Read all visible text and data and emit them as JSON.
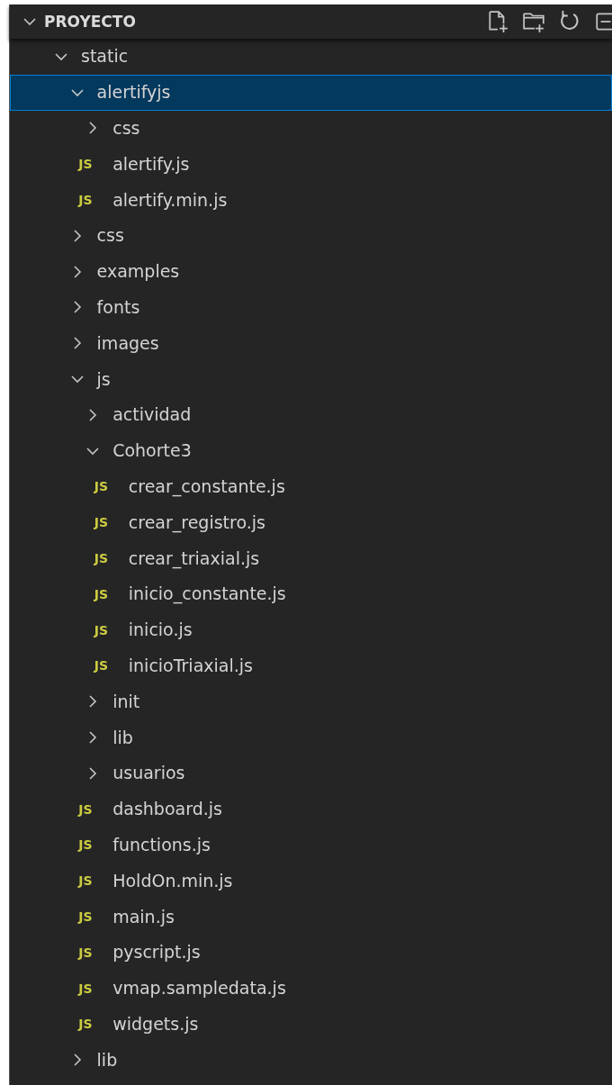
{
  "explorer": {
    "title": "PROYECTO",
    "expanded": true
  },
  "tree": [
    {
      "kind": "folder",
      "name": "static",
      "expanded": true,
      "selected": false,
      "children": [
        {
          "kind": "folder",
          "name": "alertifyjs",
          "expanded": true,
          "selected": true,
          "children": [
            {
              "kind": "folder",
              "name": "css",
              "expanded": false,
              "selected": false
            },
            {
              "kind": "file",
              "icon_text": "JS",
              "name": "alertify.js",
              "selected": false
            },
            {
              "kind": "file",
              "icon_text": "JS",
              "name": "alertify.min.js",
              "selected": false
            }
          ]
        },
        {
          "kind": "folder",
          "name": "css",
          "expanded": false,
          "selected": false
        },
        {
          "kind": "folder",
          "name": "examples",
          "expanded": false,
          "selected": false
        },
        {
          "kind": "folder",
          "name": "fonts",
          "expanded": false,
          "selected": false
        },
        {
          "kind": "folder",
          "name": "images",
          "expanded": false,
          "selected": false
        },
        {
          "kind": "folder",
          "name": "js",
          "expanded": true,
          "selected": false,
          "children": [
            {
              "kind": "folder",
              "name": "actividad",
              "expanded": false,
              "selected": false
            },
            {
              "kind": "folder",
              "name": "Cohorte3",
              "expanded": true,
              "selected": false,
              "children": [
                {
                  "kind": "file",
                  "icon_text": "JS",
                  "name": "crear_constante.js",
                  "selected": false
                },
                {
                  "kind": "file",
                  "icon_text": "JS",
                  "name": "crear_registro.js",
                  "selected": false
                },
                {
                  "kind": "file",
                  "icon_text": "JS",
                  "name": "crear_triaxial.js",
                  "selected": false
                },
                {
                  "kind": "file",
                  "icon_text": "JS",
                  "name": "inicio_constante.js",
                  "selected": false
                },
                {
                  "kind": "file",
                  "icon_text": "JS",
                  "name": "inicio.js",
                  "selected": false
                },
                {
                  "kind": "file",
                  "icon_text": "JS",
                  "name": "inicioTriaxial.js",
                  "selected": false
                }
              ]
            },
            {
              "kind": "folder",
              "name": "init",
              "expanded": false,
              "selected": false
            },
            {
              "kind": "folder",
              "name": "lib",
              "expanded": false,
              "selected": false
            },
            {
              "kind": "folder",
              "name": "usuarios",
              "expanded": false,
              "selected": false
            },
            {
              "kind": "file",
              "icon_text": "JS",
              "name": "dashboard.js",
              "selected": false
            },
            {
              "kind": "file",
              "icon_text": "JS",
              "name": "functions.js",
              "selected": false
            },
            {
              "kind": "file",
              "icon_text": "JS",
              "name": "HoldOn.min.js",
              "selected": false
            },
            {
              "kind": "file",
              "icon_text": "JS",
              "name": "main.js",
              "selected": false
            },
            {
              "kind": "file",
              "icon_text": "JS",
              "name": "pyscript.js",
              "selected": false
            },
            {
              "kind": "file",
              "icon_text": "JS",
              "name": "vmap.sampledata.js",
              "selected": false
            },
            {
              "kind": "file",
              "icon_text": "JS",
              "name": "widgets.js",
              "selected": false
            }
          ]
        },
        {
          "kind": "folder",
          "name": "lib",
          "expanded": false,
          "selected": false
        }
      ]
    }
  ]
}
